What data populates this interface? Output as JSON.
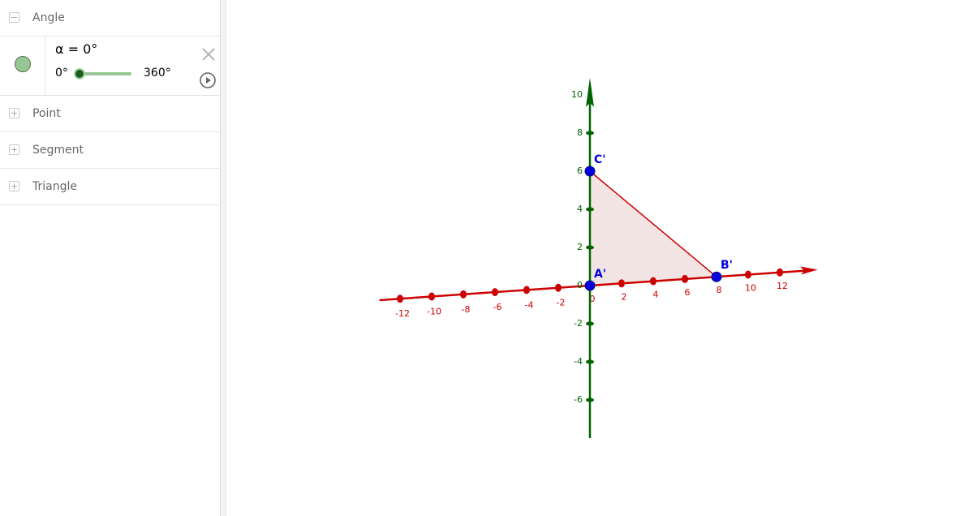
{
  "algebra": {
    "groups": [
      {
        "label": "Angle",
        "toggle": "−"
      },
      {
        "label": "Point",
        "toggle": "+"
      },
      {
        "label": "Segment",
        "toggle": "+"
      },
      {
        "label": "Triangle",
        "toggle": "+"
      }
    ],
    "angle_item": {
      "definition": "α = 0°",
      "slider_min_label": "0°",
      "slider_max_label": "360°",
      "slider_value_fraction": 0,
      "marble_color": "#97c694"
    },
    "icons": {
      "close": "close-icon",
      "play": "play-icon"
    }
  },
  "graphics": {
    "x_axis": {
      "color": "#cc0000",
      "ticks": [
        -12,
        -10,
        -8,
        -6,
        -4,
        -2,
        0,
        2,
        4,
        6,
        8,
        10,
        12
      ]
    },
    "y_axis": {
      "color": "#006400",
      "ticks": [
        -6,
        -4,
        -2,
        0,
        2,
        4,
        6,
        8,
        10
      ]
    },
    "points": [
      {
        "name": "A'",
        "x": 0,
        "y": 0
      },
      {
        "name": "B'",
        "x": 8,
        "y": 0
      },
      {
        "name": "C'",
        "x": 0,
        "y": 6
      }
    ],
    "triangle": {
      "vertices": [
        "A'",
        "B'",
        "C'"
      ],
      "fill": "#f2e4e2",
      "edge_color": "#cc0000"
    },
    "point_color": "#0000dd"
  }
}
